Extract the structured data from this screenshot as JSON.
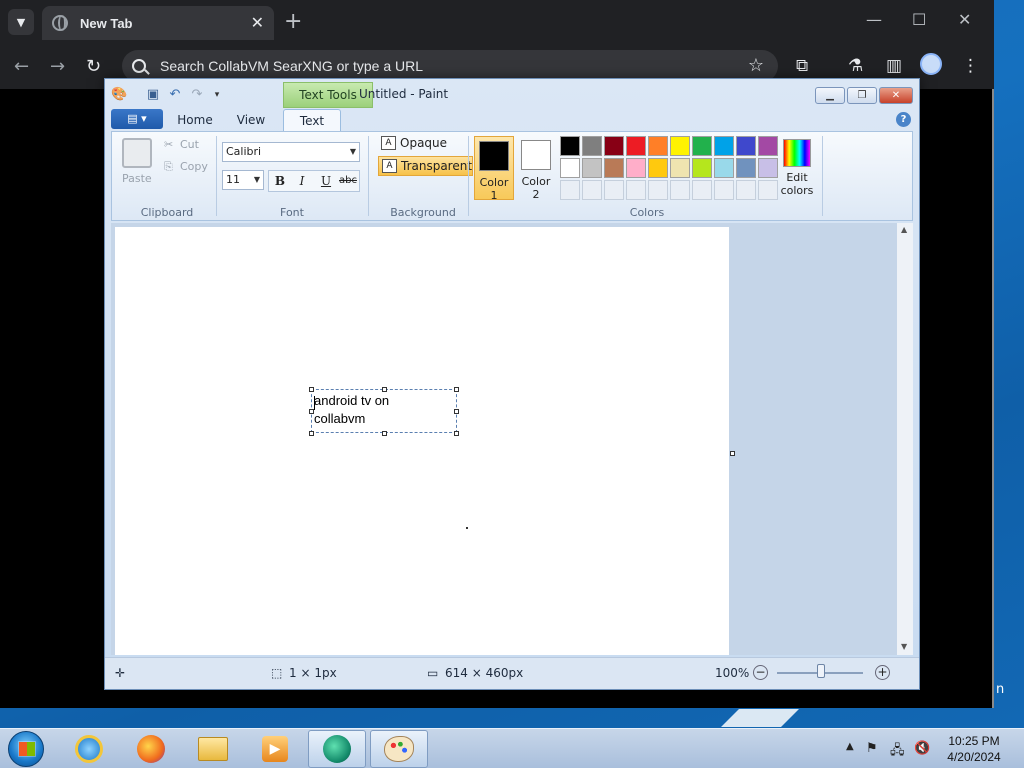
{
  "browser": {
    "tab_title": "New Tab",
    "tab_close": "✕",
    "new_tab": "+",
    "omnibox_placeholder": "Search CollabVM SearXNG or type a URL"
  },
  "paint": {
    "window_title": "Untitled - Paint",
    "contextual_tab": "Text Tools",
    "tabs": [
      "Home",
      "View",
      "Text"
    ],
    "active_tab": "Text",
    "clipboard": {
      "paste": "Paste",
      "cut": "Cut",
      "copy": "Copy",
      "label": "Clipboard"
    },
    "font": {
      "family": "Calibri",
      "size": "11",
      "bold": "B",
      "italic": "I",
      "underline": "U",
      "strike": "abc",
      "label": "Font"
    },
    "background": {
      "opaque": "Opaque",
      "transparent": "Transparent",
      "label": "Background",
      "selected": "Transparent"
    },
    "colors": {
      "color1_label": "Color\n1",
      "color2_label": "Color\n2",
      "color1": "#000000",
      "color2": "#ffffff",
      "label": "Colors",
      "edit_label": "Edit\ncolors",
      "palette_row1": [
        "#000000",
        "#7f7f7f",
        "#880015",
        "#ed1c24",
        "#ff7f27",
        "#fff200",
        "#22b14c",
        "#00a2e8",
        "#3f48cc",
        "#a349a4"
      ],
      "palette_row2": [
        "#ffffff",
        "#c3c3c3",
        "#b97a57",
        "#ffaec9",
        "#ffc90e",
        "#efe4b0",
        "#b5e61d",
        "#99d9ea",
        "#7092be",
        "#c8bfe7"
      ]
    },
    "text_content": {
      "line1": "android tv on",
      "line2": "collabvm"
    },
    "status": {
      "selection": "1 × 1px",
      "canvas_size": "614 × 460px",
      "zoom": "100%"
    }
  },
  "taskbar": {
    "time": "10:25 PM",
    "date": "4/20/2024",
    "apps": [
      "internet-explorer",
      "firefox",
      "file-explorer",
      "media-player",
      "browser-app",
      "paint"
    ]
  },
  "page_edge_text": "n"
}
